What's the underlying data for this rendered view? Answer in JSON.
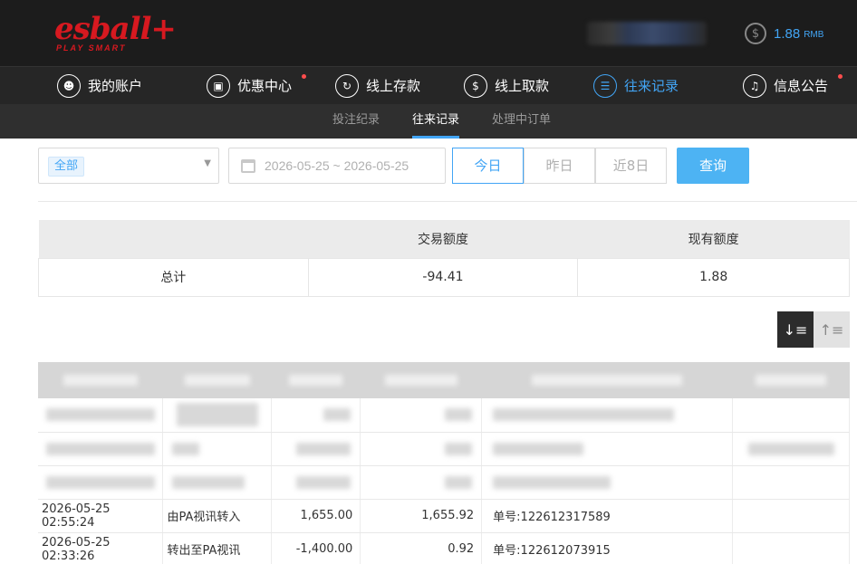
{
  "header": {
    "logo_main": "esball+",
    "logo_sub": "PLAY SMART",
    "balance_icon": "dollar-coin-icon",
    "balance_amount": "1.88",
    "balance_unit": "RMB"
  },
  "nav": {
    "items": [
      {
        "label": "我的账户",
        "icon": "user-icon",
        "active": false,
        "dot": false
      },
      {
        "label": "优惠中心",
        "icon": "gift-icon",
        "active": false,
        "dot": true
      },
      {
        "label": "线上存款",
        "icon": "deposit-icon",
        "active": false,
        "dot": false
      },
      {
        "label": "线上取款",
        "icon": "withdraw-icon",
        "active": false,
        "dot": false
      },
      {
        "label": "往来记录",
        "icon": "records-icon",
        "active": true,
        "dot": false
      },
      {
        "label": "信息公告",
        "icon": "bell-icon",
        "active": false,
        "dot": true
      }
    ]
  },
  "subnav": {
    "items": [
      "投注纪录",
      "往来记录",
      "处理中订单"
    ],
    "active_index": 1
  },
  "filters": {
    "type_value": "全部",
    "date_range": "2026-05-25 ~ 2026-05-25",
    "quick_ranges": [
      "今日",
      "昨日",
      "近8日"
    ],
    "active_range": 0,
    "query_label": "查询"
  },
  "summary": {
    "headers": [
      "",
      "交易额度",
      "现有额度"
    ],
    "row_label": "总计",
    "transaction_amount": "-94.41",
    "current_balance": "1.88"
  },
  "sort": {
    "desc_icon": "sort-descending-icon",
    "asc_icon": "sort-ascending-icon"
  },
  "transactions": {
    "rows": [
      {
        "time": "2026-05-25 02:55:24",
        "type": "由PA视讯转入",
        "amount": "1,655.00",
        "balance": "1,655.92",
        "order": "单号:122612317589",
        "note": ""
      },
      {
        "time": "2026-05-25 02:33:26",
        "type": "转出至PA视讯",
        "amount": "-1,400.00",
        "balance": "0.92",
        "order": "单号:122612073915",
        "note": ""
      }
    ]
  },
  "colors": {
    "accent": "#42a5f5",
    "brand_red": "#d71920",
    "header_bg": "#1c1c1c",
    "nav_bg": "#262626",
    "subnav_bg": "#2f2f2f"
  }
}
